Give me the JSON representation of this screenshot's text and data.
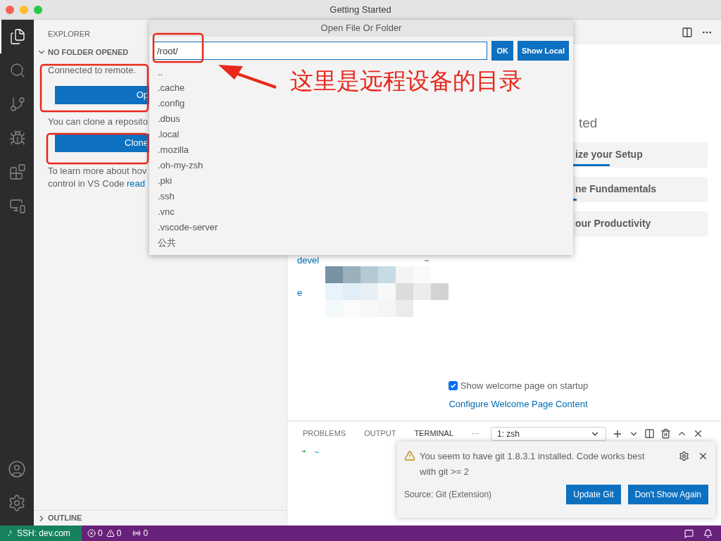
{
  "window": {
    "title": "Getting Started"
  },
  "activity_bar": [
    {
      "kind": "files",
      "selected": true
    },
    {
      "kind": "search",
      "selected": false
    },
    {
      "kind": "source-control",
      "selected": false
    },
    {
      "kind": "run",
      "selected": false
    },
    {
      "kind": "extensions",
      "selected": false
    },
    {
      "kind": "remote",
      "selected": false
    }
  ],
  "sidebar": {
    "title": "EXPLORER",
    "section": {
      "label": "NO FOLDER OPENED",
      "expanded": true
    },
    "connected_text": "Connected to remote.",
    "open_button": "Op",
    "clone_text": "You can clone a reposito",
    "clone_button": "Clone",
    "learn_line_1": "To learn more about hov",
    "learn_line_2": "control in VS Code ",
    "learn_link": "read",
    "outline": {
      "label": "OUTLINE",
      "expanded": false
    }
  },
  "dialog": {
    "title": "Open File Or Folder",
    "path_value": "/root/",
    "ok_button": "OK",
    "show_local_button": "Show Local",
    "entries": [
      "..",
      ".cache",
      ".config",
      ".dbus",
      ".local",
      ".mozilla",
      ".oh-my-zsh",
      ".pki",
      ".ssh",
      ".vnc",
      ".vscode-server",
      "公共"
    ]
  },
  "annotation": {
    "text": "这里是远程设备的目录"
  },
  "welcome": {
    "heading": "ted",
    "cards": [
      {
        "label": "ize your Setup",
        "level": 0.35
      },
      {
        "label": "ne Fundamentals",
        "level": 0.13
      },
      {
        "label": "our Productivity"
      }
    ],
    "recent_1": "devel",
    "recent_1_suffix": "~",
    "recent_2": "e",
    "show_on_startup": {
      "label": "Show welcome page on startup",
      "checked": true
    },
    "configure_link": "Configure Welcome Page Content"
  },
  "panel": {
    "tabs": [
      {
        "label": "PROBLEMS",
        "selected": false
      },
      {
        "label": "OUTPUT",
        "selected": false
      },
      {
        "label": "TERMINAL",
        "selected": true
      }
    ],
    "more": "···",
    "terminal_select": "1: zsh",
    "prompt_arrow": "➜",
    "prompt_dir": "~"
  },
  "notification": {
    "message": "You seem to have git 1.8.3.1 installed. Code works best with git >= 2",
    "source": "Source: Git (Extension)",
    "buttons": [
      "Update Git",
      "Don't Show Again"
    ]
  },
  "status_bar": {
    "remote": "SSH: dev.com",
    "errors": "0",
    "warnings": "0",
    "ports": "0"
  }
}
